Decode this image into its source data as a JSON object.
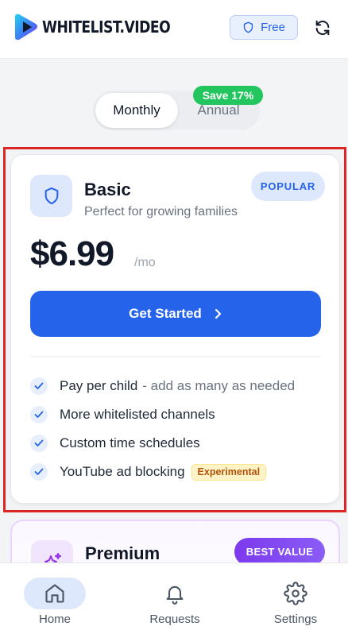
{
  "header": {
    "brand": "Whitelist.Video",
    "plan_chip": "Free"
  },
  "billing_toggle": {
    "monthly": "Monthly",
    "annual": "Annual",
    "annual_badge": "Save 17%",
    "selected": "Monthly"
  },
  "basic_plan": {
    "name": "Basic",
    "description": "Perfect for growing families",
    "badge": "POPULAR",
    "price": "$6.99",
    "period": "/mo",
    "cta": "Get Started",
    "features": [
      {
        "text": "Pay per child",
        "note": "- add as many as needed"
      },
      {
        "text": "More whitelisted channels"
      },
      {
        "text": "Custom time schedules"
      },
      {
        "text": "YouTube ad blocking",
        "badge": "Experimental"
      }
    ]
  },
  "premium_plan": {
    "name": "Premium",
    "badge": "BEST VALUE"
  },
  "bottom_nav": {
    "items": [
      {
        "label": "Home",
        "icon": "home-icon",
        "active": true
      },
      {
        "label": "Requests",
        "icon": "bell-icon",
        "active": false
      },
      {
        "label": "Settings",
        "icon": "gear-icon",
        "active": false
      }
    ]
  },
  "colors": {
    "primary": "#2563eb",
    "accent_green": "#22c55e",
    "premium_purple": "#7c3aed",
    "highlight_red": "#dc2626"
  }
}
